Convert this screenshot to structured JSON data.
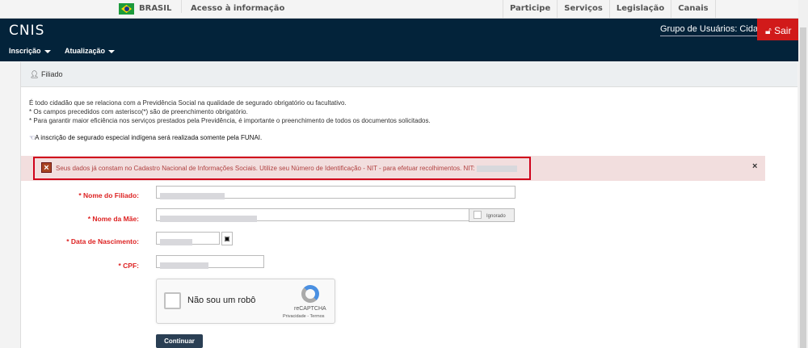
{
  "gov": {
    "brasil": "BRASIL",
    "acesso": "Acesso à informação",
    "links": [
      "Participe",
      "Serviços",
      "Legislação",
      "Canais"
    ]
  },
  "header": {
    "logo": "CNIS",
    "group": "Grupo de Usuários: Cidadão",
    "logout": "Sair",
    "menu": [
      "Inscrição",
      "Atualização"
    ]
  },
  "panel": {
    "title": "Filiado",
    "intro": [
      "É todo cidadão que se relaciona com a Previdência Social na qualidade de segurado obrigatório ou facultativo.",
      "* Os campos precedidos com asterisco(*) são de preenchimento obrigatório.",
      "* Para garantir maior eficiência nos serviços prestados pela Previdência, é importante o preenchimento de todos os documentos solicitados."
    ],
    "note": "A inscrição de segurado especial indígena será realizada somente pela FUNAI.",
    "alert": "Seus dados já constam no Cadastro Nacional de Informações Sociais. Utilize seu Número de Identificação - NIT - para efetuar recolhimentos. NIT:",
    "alert_close": "×"
  },
  "form": {
    "nome_label": "* Nome do Filiado:",
    "mae_label": "* Nome da Mãe:",
    "ignorado": "Ignorado",
    "nasc_label": "* Data de Nascimento:",
    "cpf_label": "* CPF:"
  },
  "captcha": {
    "label": "Não sou um robô",
    "brand": "reCAPTCHA",
    "links": "Privacidade - Termos"
  },
  "submit": "Continuar"
}
